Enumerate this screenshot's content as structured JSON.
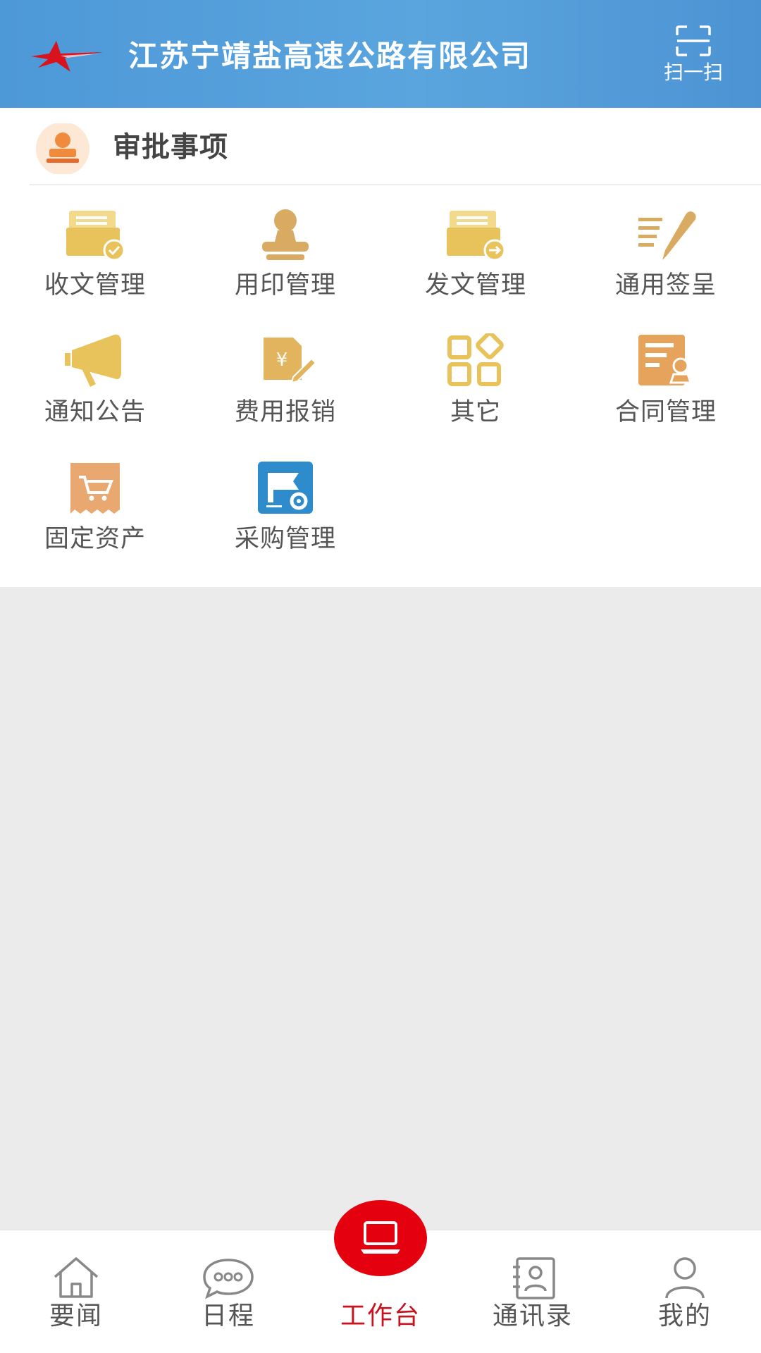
{
  "header": {
    "company_name": "江苏宁靖盐高速公路有限公司",
    "scan_label": "扫一扫",
    "scan_icon": "scan-icon",
    "logo_icon": "red-star-logo"
  },
  "approval": {
    "title": "审批事项",
    "icon": "stamp-person-icon",
    "items": [
      {
        "label": "收文管理",
        "icon": "receive-document-icon",
        "color": "#e8c25a"
      },
      {
        "label": "用印管理",
        "icon": "seal-stamp-icon",
        "color": "#d9ab62"
      },
      {
        "label": "发文管理",
        "icon": "send-document-icon",
        "color": "#e8c25a"
      },
      {
        "label": "通用签呈",
        "icon": "sign-pen-icon",
        "color": "#d9ab62"
      },
      {
        "label": "通知公告",
        "icon": "megaphone-icon",
        "color": "#e8c25a"
      },
      {
        "label": "费用报销",
        "icon": "expense-yen-icon",
        "color": "#e2b45d"
      },
      {
        "label": "其它",
        "icon": "apps-grid-icon",
        "color": "#e8c25a"
      },
      {
        "label": "合同管理",
        "icon": "contract-icon",
        "color": "#e6a35b"
      },
      {
        "label": "固定资产",
        "icon": "cart-receipt-icon",
        "color": "#e8a870"
      },
      {
        "label": "采购管理",
        "icon": "purchase-flag-icon",
        "color": "#2f8ccc"
      }
    ]
  },
  "nav": {
    "items": [
      {
        "label": "要闻",
        "icon": "home-icon",
        "active": false
      },
      {
        "label": "日程",
        "icon": "chat-bubble-icon",
        "active": false
      },
      {
        "label": "工作台",
        "icon": "laptop-icon",
        "active": true
      },
      {
        "label": "通讯录",
        "icon": "contacts-book-icon",
        "active": false
      },
      {
        "label": "我的",
        "icon": "user-icon",
        "active": false
      }
    ],
    "active_color": "#c8131f"
  }
}
